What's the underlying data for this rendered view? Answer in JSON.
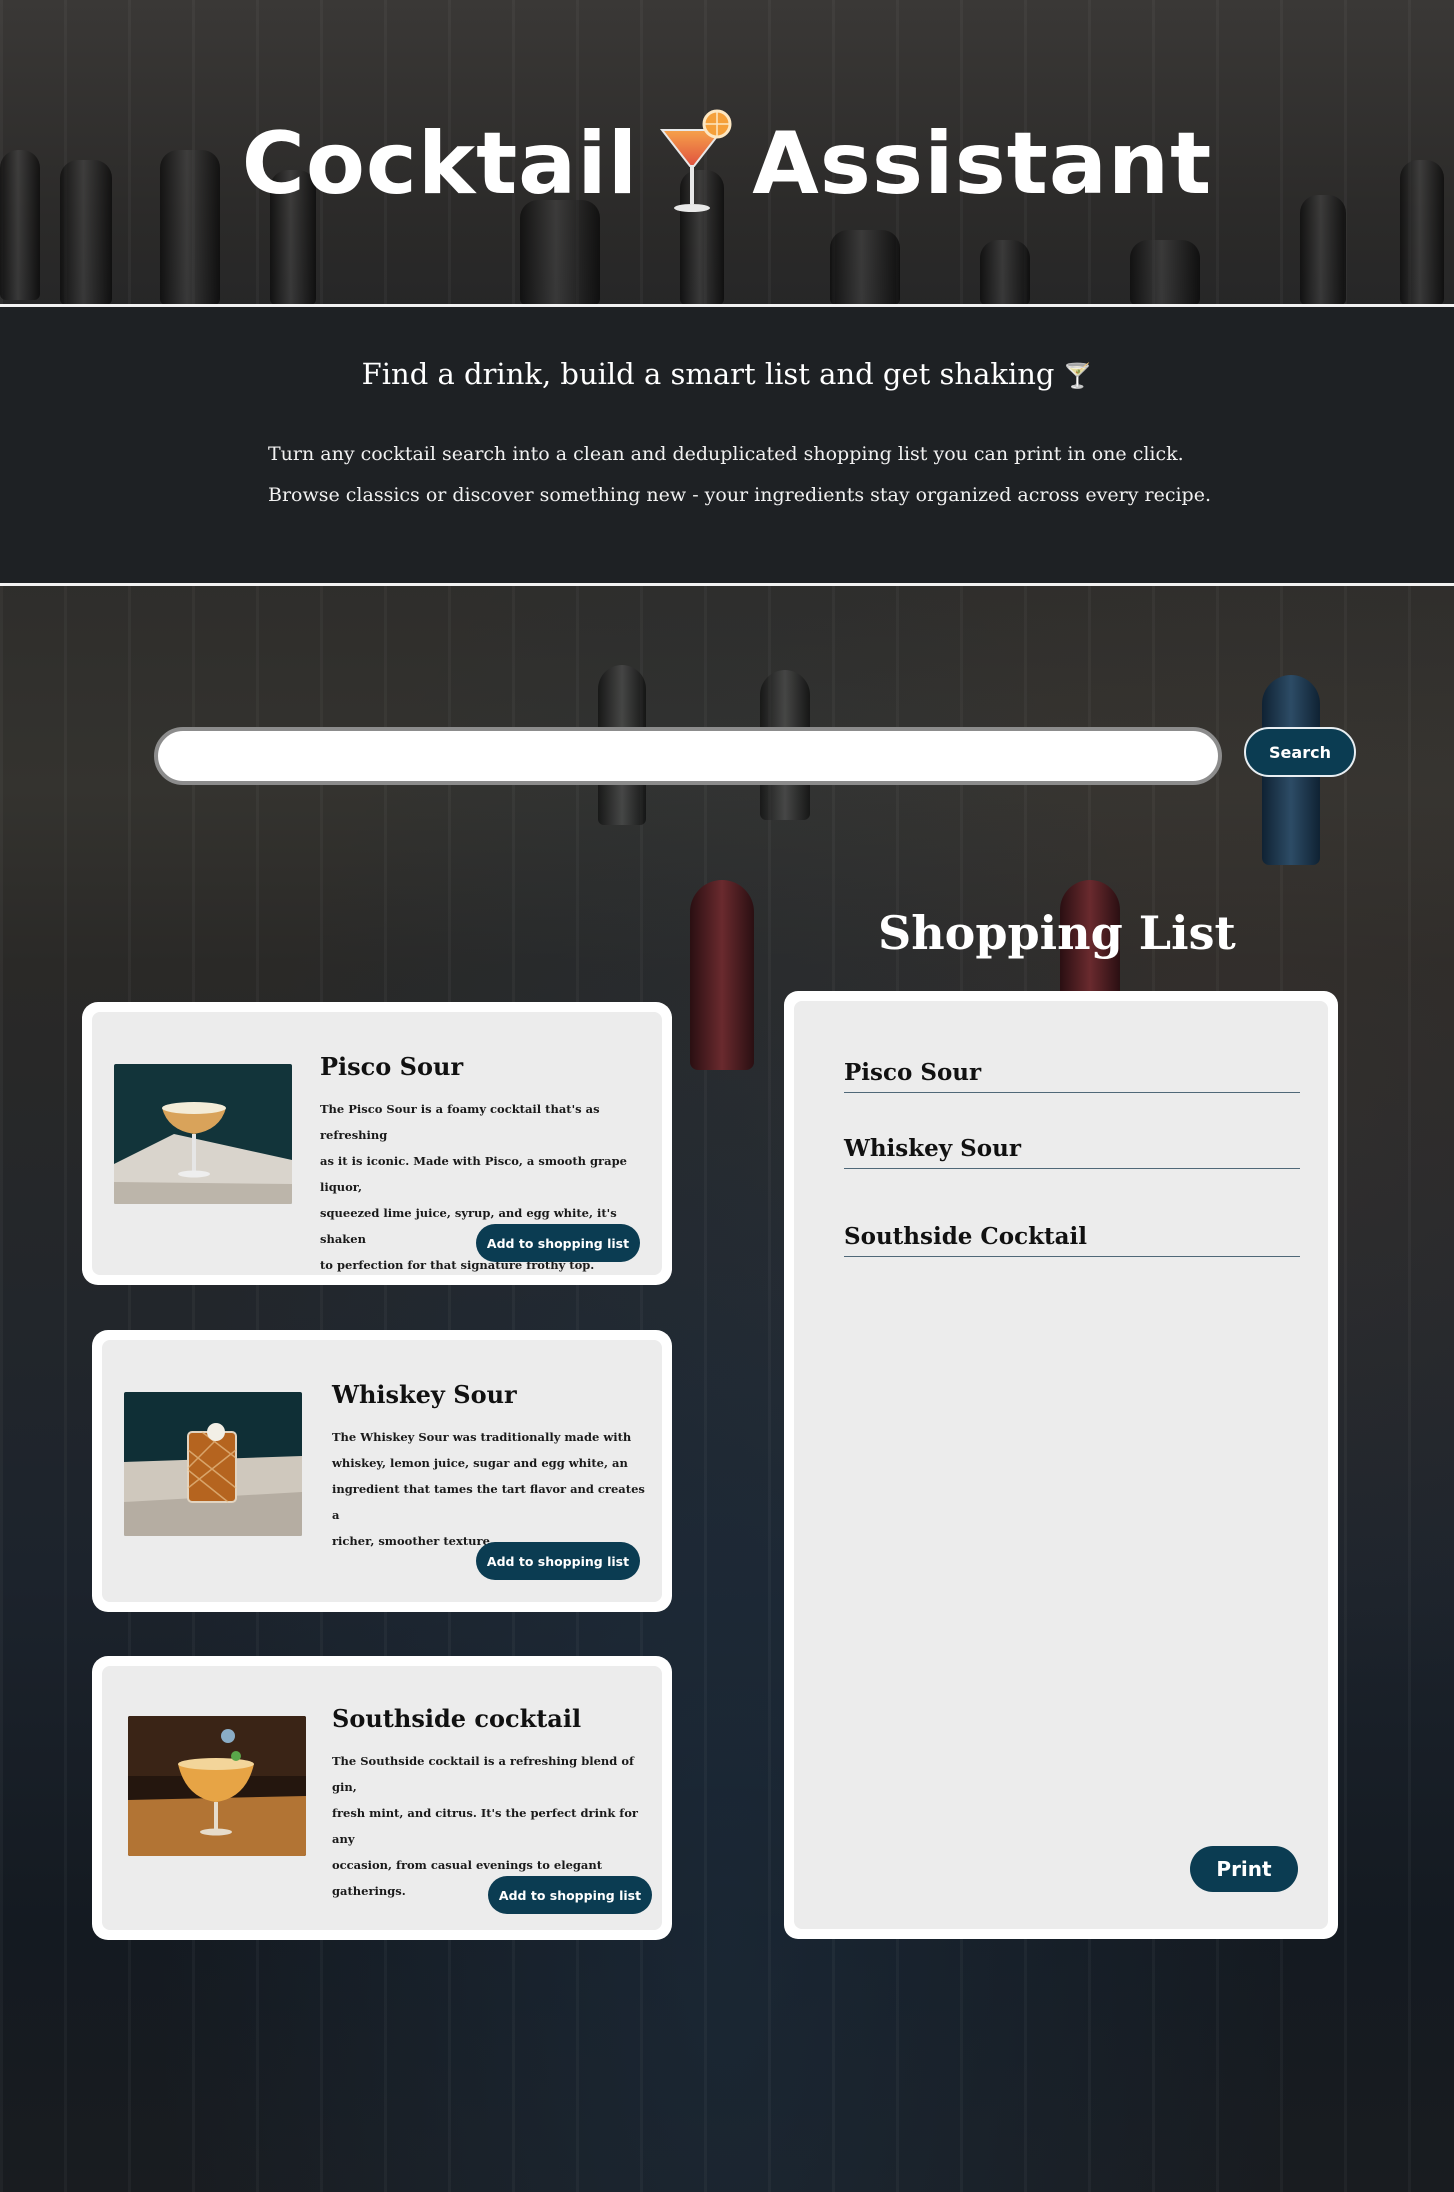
{
  "header": {
    "title_left": "Cocktail",
    "title_right": "Assistant",
    "title_icon": "cocktail-glass-icon"
  },
  "intro": {
    "tagline": "Find a drink, build a smart list and get shaking",
    "tagline_icon": "martini-glass-icon",
    "line1": "Turn any cocktail search into a clean and  deduplicated shopping list you can print in one click.",
    "line2": "Browse classics or discover something new - your ingredients stay organized across every recipe."
  },
  "search": {
    "value": "",
    "placeholder": "",
    "button_label": "Search"
  },
  "cocktails": [
    {
      "title": "Pisco Sour",
      "description_lines": [
        "The Pisco Sour is a foamy cocktail that's as refreshing",
        "as it is iconic. Made with Pisco, a smooth grape liquor,",
        "squeezed lime juice,  syrup, and egg white, it's shaken",
        "to perfection for that signature  frothy top."
      ],
      "button_label": "Add to shopping list"
    },
    {
      "title": "Whiskey Sour",
      "description_lines": [
        "The Whiskey Sour was traditionally made with",
        "whiskey, lemon juice, sugar and egg white, an",
        "ingredient that tames the tart flavor and creates a",
        "richer, smoother texture."
      ],
      "button_label": "Add to shopping list"
    },
    {
      "title": "Southside cocktail",
      "description_lines": [
        "The Southside cocktail is a refreshing blend of gin,",
        "fresh mint, and citrus. It's the perfect drink for any",
        "occasion, from casual evenings to elegant gatherings."
      ],
      "button_label": "Add to shopping list"
    }
  ],
  "shopping_list": {
    "heading": "Shopping List",
    "items": [
      "Pisco Sour",
      "Whiskey Sour",
      "Southside Cocktail"
    ],
    "print_label": "Print"
  },
  "colors": {
    "accent": "#0b3c52",
    "card_bg": "#ececec",
    "band_bg": "#1e2124"
  }
}
